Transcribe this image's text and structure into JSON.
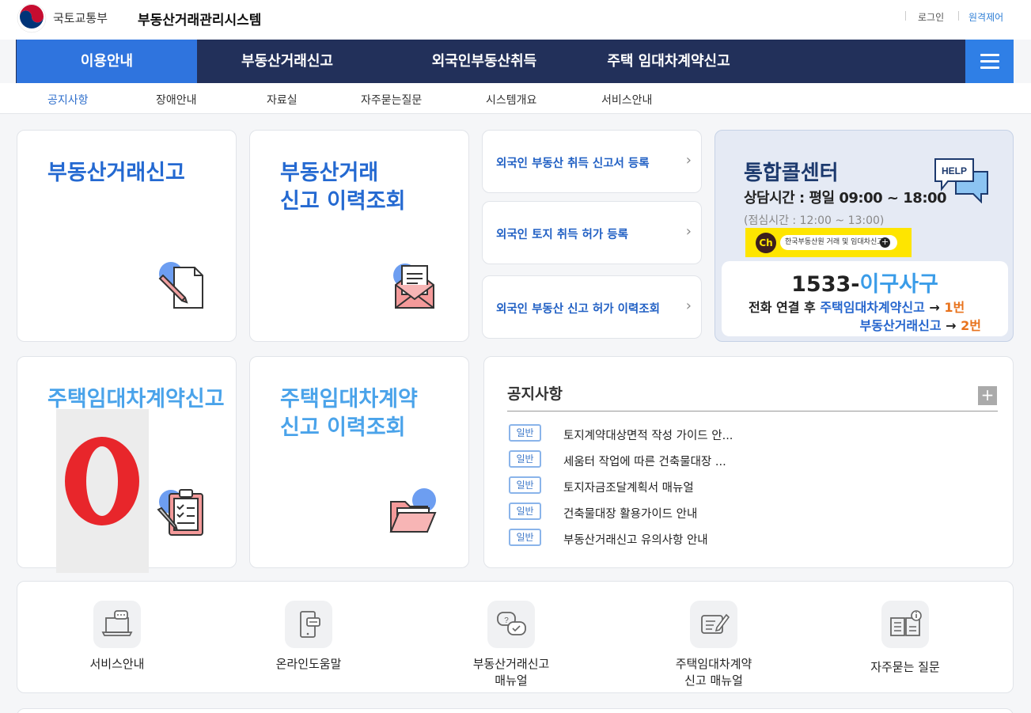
{
  "header": {
    "ministry": "국토교통부",
    "system_name": "부동산거래관리시스템",
    "login": "로그인",
    "remote": "원격제어"
  },
  "gnb": {
    "items": [
      "이용안내",
      "부동산거래신고",
      "외국인부동산취득",
      "주택 임대차계약신고"
    ],
    "active_index": 0
  },
  "lnb": {
    "items": [
      "공지사항",
      "장애안내",
      "자료실",
      "자주묻는질문",
      "시스템개요",
      "서비스안내"
    ],
    "active_index": 0
  },
  "cards": {
    "report": "부동산거래신고",
    "report_history_1": "부동산거래",
    "report_history_2": "신고 이력조회",
    "lease": "주택임대차계약신고",
    "lease_history_1": "주택임대차계약",
    "lease_history_2": "신고 이력조회"
  },
  "links": [
    "외국인 부동산 취득 신고서 등록",
    "외국인 토지 취득 허가 등록",
    "외국인 부동산 신고 허가 이력조회"
  ],
  "call_center": {
    "title": "통합콜센터",
    "hours": "상담시간 : 평일 09:00 ~ 18:00",
    "lunch": "(점심시간 : 12:00 ~ 13:00)",
    "kakao_badge": "Ch",
    "kakao_text": "한국부동산원 거래 및 임대차신고",
    "help_badge": "HELP",
    "phone_prefix": "1533-",
    "phone_word": "이구사구",
    "line1_prefix": "전화 연결 후 ",
    "line1_service": "주택임대차계약신고",
    "line1_num": "1번",
    "line2_service": "부동산거래신고",
    "line2_num": "2번",
    "arrow": "→"
  },
  "notice": {
    "title": "공지사항",
    "more": "+",
    "items": [
      {
        "badge": "일반",
        "text": "토지계약대상면적 작성 가이드 안..."
      },
      {
        "badge": "일반",
        "text": "세움터 작업에 따른 건축물대장 ..."
      },
      {
        "badge": "일반",
        "text": "토지자금조달계획서 매뉴얼"
      },
      {
        "badge": "일반",
        "text": "건축물대장 활용가이드 안내"
      },
      {
        "badge": "일반",
        "text": "부동산거래신고 유의사항 안내"
      }
    ]
  },
  "quick": {
    "service": "서비스안내",
    "help": "온라인도움말",
    "manual_1": "부동산거래신고",
    "manual_2": "매뉴얼",
    "lease_manual_1": "주택임대차계약",
    "lease_manual_2": "신고 매뉴얼",
    "faq": "자주묻는 질문"
  },
  "colors": {
    "navy": "#22305a",
    "active_blue": "#2f74de",
    "title_blue": "#2469d1",
    "light_blue": "#4aa3ea",
    "orange": "#e8731d",
    "opera_red": "#e8262b"
  }
}
